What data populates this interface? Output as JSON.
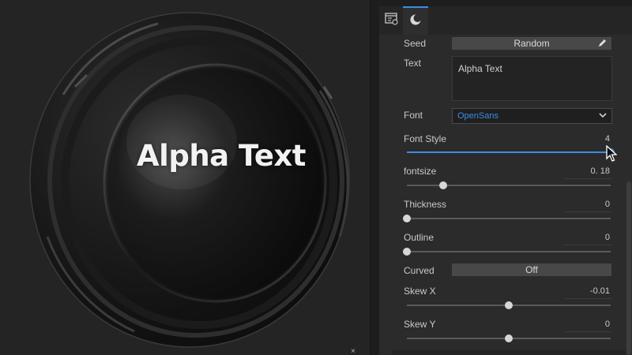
{
  "viewport": {
    "rendered_text": "Alpha Text",
    "close_label": "×"
  },
  "tabs": [
    {
      "name": "settings",
      "icon": "settings-panel-icon"
    },
    {
      "name": "render",
      "icon": "moon-icon",
      "active": true
    }
  ],
  "properties": {
    "seed": {
      "label": "Seed",
      "button": "Random",
      "icon": "pencil-icon"
    },
    "text": {
      "label": "Text",
      "value": "Alpha Text"
    },
    "font": {
      "label": "Font",
      "selected": "OpenSans",
      "icon": "chevron-down-icon"
    },
    "font_style": {
      "label": "Font Style",
      "value": "4",
      "slider_fraction": 1.0
    },
    "fontsize": {
      "label": "fontsize",
      "value": "0. 18",
      "slider_fraction": 0.18
    },
    "thickness": {
      "label": "Thickness",
      "value": "0",
      "slider_fraction": 0.0
    },
    "outline": {
      "label": "Outline",
      "value": "0",
      "slider_fraction": 0.0
    },
    "curved": {
      "label": "Curved",
      "button": "Off"
    },
    "skew_x": {
      "label": "Skew X",
      "value": "-0.01",
      "slider_fraction": 0.5
    },
    "skew_y": {
      "label": "Skew Y",
      "value": "0",
      "slider_fraction": 0.5
    }
  },
  "colors": {
    "accent": "#3a8ee6",
    "panel_bg": "#2b2b2b",
    "viewport_bg": "#242424"
  }
}
